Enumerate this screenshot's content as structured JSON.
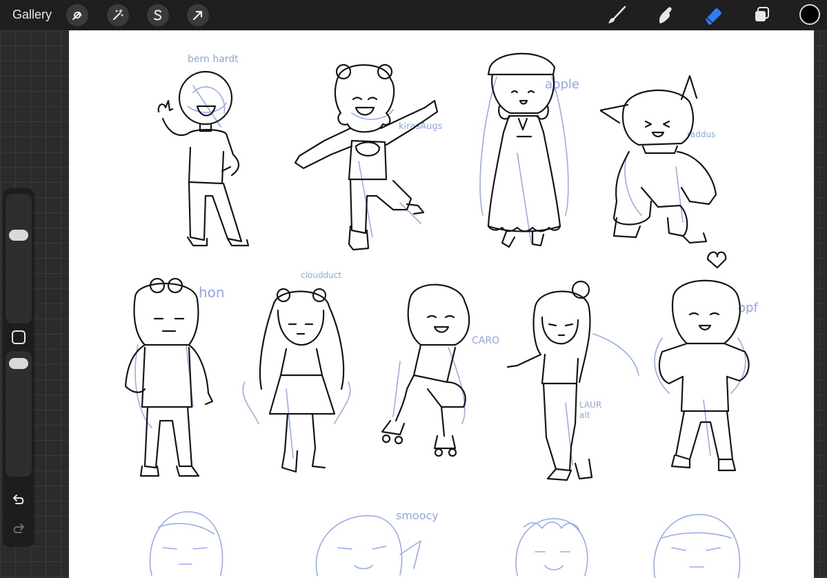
{
  "app": {
    "gallery_label": "Gallery",
    "top_left_tools": [
      {
        "name": "actions",
        "icon": "wrench-icon"
      },
      {
        "name": "adjustments",
        "icon": "magic-wand-icon"
      },
      {
        "name": "selection",
        "icon": "selection-s-icon"
      },
      {
        "name": "transform",
        "icon": "arrow-cursor-icon"
      }
    ],
    "top_right_tools": [
      {
        "name": "brush",
        "icon": "brush-icon",
        "active": false
      },
      {
        "name": "smudge",
        "icon": "smudge-finger-icon",
        "active": false
      },
      {
        "name": "eraser",
        "icon": "eraser-icon",
        "active": true
      },
      {
        "name": "layers",
        "icon": "layers-icon",
        "active": false
      }
    ],
    "current_color": "#000000",
    "accent_color": "#2f7df6"
  },
  "sidebar": {
    "size_slider_level": 0.71,
    "opacity_slider_level": 0.96,
    "buttons": [
      "modify-square-icon",
      "undo-icon",
      "redo-icon"
    ]
  },
  "canvas": {
    "background": "#ffffff",
    "labels": [
      "bern hardt",
      "kirasAugs",
      "apple",
      "raddus",
      "hon",
      "cloudduct",
      "CARO",
      "LAUR alt",
      "opf",
      "smoocy"
    ],
    "ink_color": "#151515",
    "sketch_color": "#97acea"
  }
}
